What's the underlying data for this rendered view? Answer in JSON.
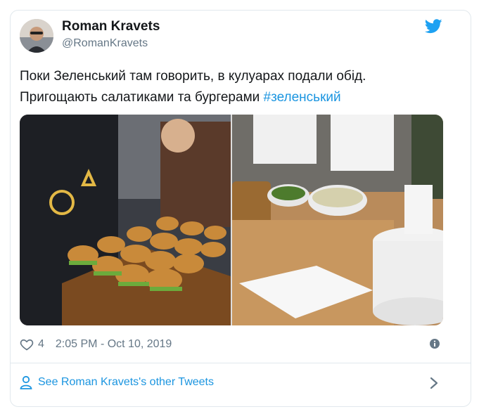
{
  "tweet": {
    "author_name": "Roman Kravets",
    "author_handle": "@RomanKravets",
    "text_line1": "Поки Зеленський там говорить, в кулуарах подали обід.",
    "text_line2": "Пригощають салатиками та бургерами ",
    "hashtag": "#зеленський",
    "likes": "4",
    "timestamp": "2:05 PM - Oct 10, 2019",
    "see_more": "See Roman Kravets's other Tweets"
  },
  "icons": {
    "brand": "twitter-bird-icon",
    "like": "heart-icon",
    "info": "info-icon",
    "profile": "person-icon",
    "chevron": "chevron-right-icon"
  },
  "colors": {
    "link": "#1b95e0",
    "text": "#14171a",
    "secondary": "#657786",
    "border": "#e1e8ed"
  }
}
